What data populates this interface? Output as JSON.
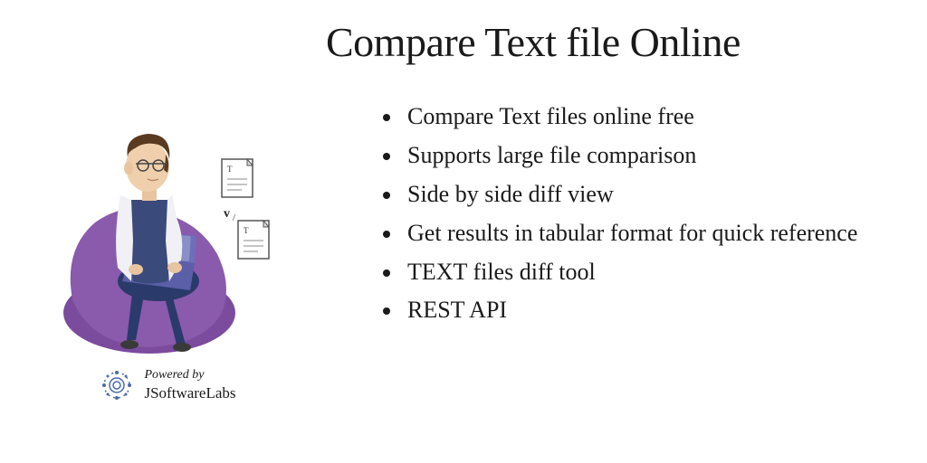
{
  "title": "Compare Text file Online",
  "features": [
    "Compare Text files online free",
    "Supports large file comparison",
    "Side by side diff view",
    "Get results in tabular format for quick reference",
    "TEXT files diff tool",
    "REST API"
  ],
  "powered": {
    "line1": "Powered by",
    "line2": "JSoftwareLabs"
  }
}
